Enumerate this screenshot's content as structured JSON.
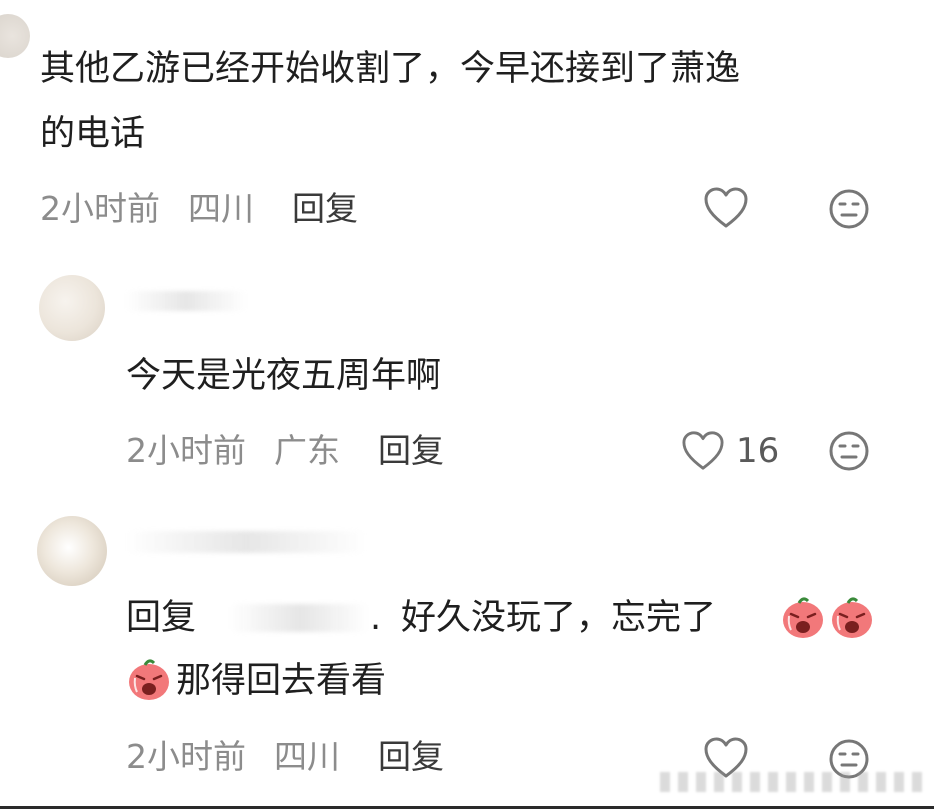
{
  "comments": [
    {
      "text_line1": "其他乙游已经开始收割了，今早还接到了萧逸",
      "text_line2": "的电话",
      "time": "2小时前",
      "location": "四川",
      "reply_label": "回复"
    },
    {
      "text": "今天是光夜五周年啊",
      "time": "2小时前",
      "location": "广东",
      "reply_label": "回复",
      "likes": "16"
    },
    {
      "reply_prefix": "回复",
      "text_part1": "好久没玩了，忘完了",
      "text_part2": "那得回去看看",
      "time": "2小时前",
      "location": "四川",
      "reply_label": "回复"
    }
  ],
  "icons": {
    "like": "heart-outline-icon",
    "react": "neutral-face-icon",
    "emoji": "crying-tomato-emoji",
    "accent_emoji": "#f2787a"
  }
}
